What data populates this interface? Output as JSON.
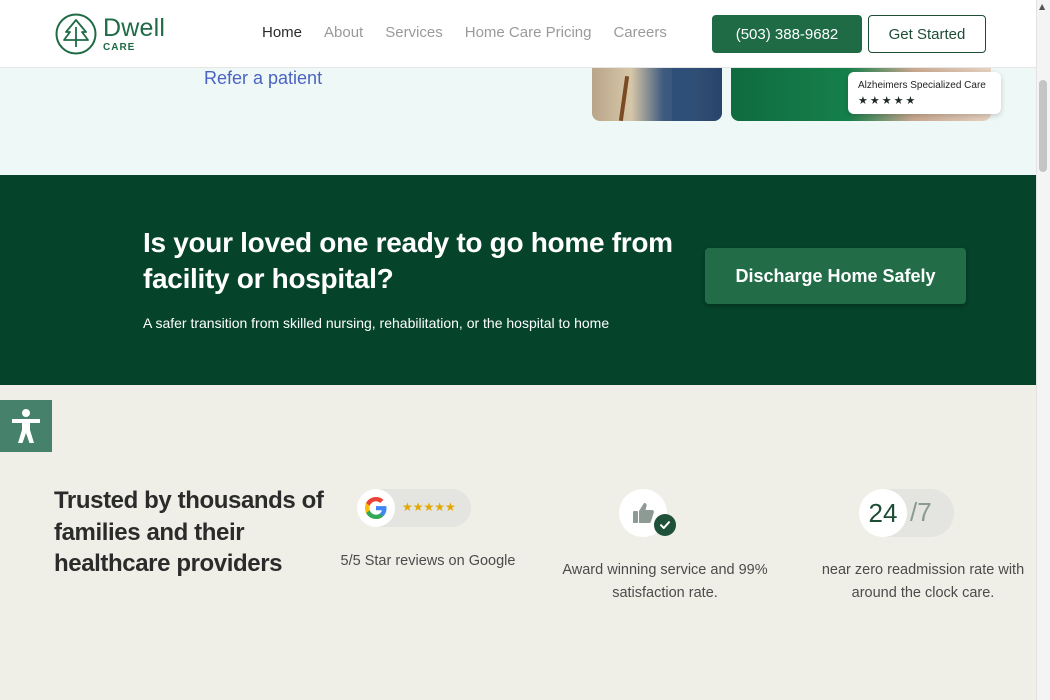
{
  "header": {
    "logo_name": "Dwell",
    "logo_sub": "CARE",
    "nav": [
      "Home",
      "About",
      "Services",
      "Home Care Pricing",
      "Careers"
    ],
    "phone_label": "(503) 388-9682",
    "cta_label": "Get Started"
  },
  "hero": {
    "refer_link": "Refer a patient",
    "rating_card": {
      "title": "Alzheimers Specialized Care",
      "stars": "★★★★★"
    }
  },
  "cta": {
    "heading": "Is your loved one ready to go home from facility or hospital?",
    "subtext": "A safer transition from skilled nursing, rehabilitation, or the hospital to home",
    "button_label": "Discharge Home Safely"
  },
  "trust": {
    "heading": "Trusted by thousands of families and their healthcare providers",
    "google": {
      "stars": "★★★★★",
      "text": "5/5 Star reviews on Google"
    },
    "award": {
      "text": "Award winning service and 99% satisfaction rate."
    },
    "availability": {
      "number": "24",
      "suffix": "/7",
      "text": "near zero readmission rate with around the clock care."
    }
  },
  "colors": {
    "brand_green": "#1e6b45",
    "band_green": "#05432b",
    "button_green": "#226d48",
    "link_blue": "#4b63c2",
    "accessibility_green": "#46826b"
  }
}
